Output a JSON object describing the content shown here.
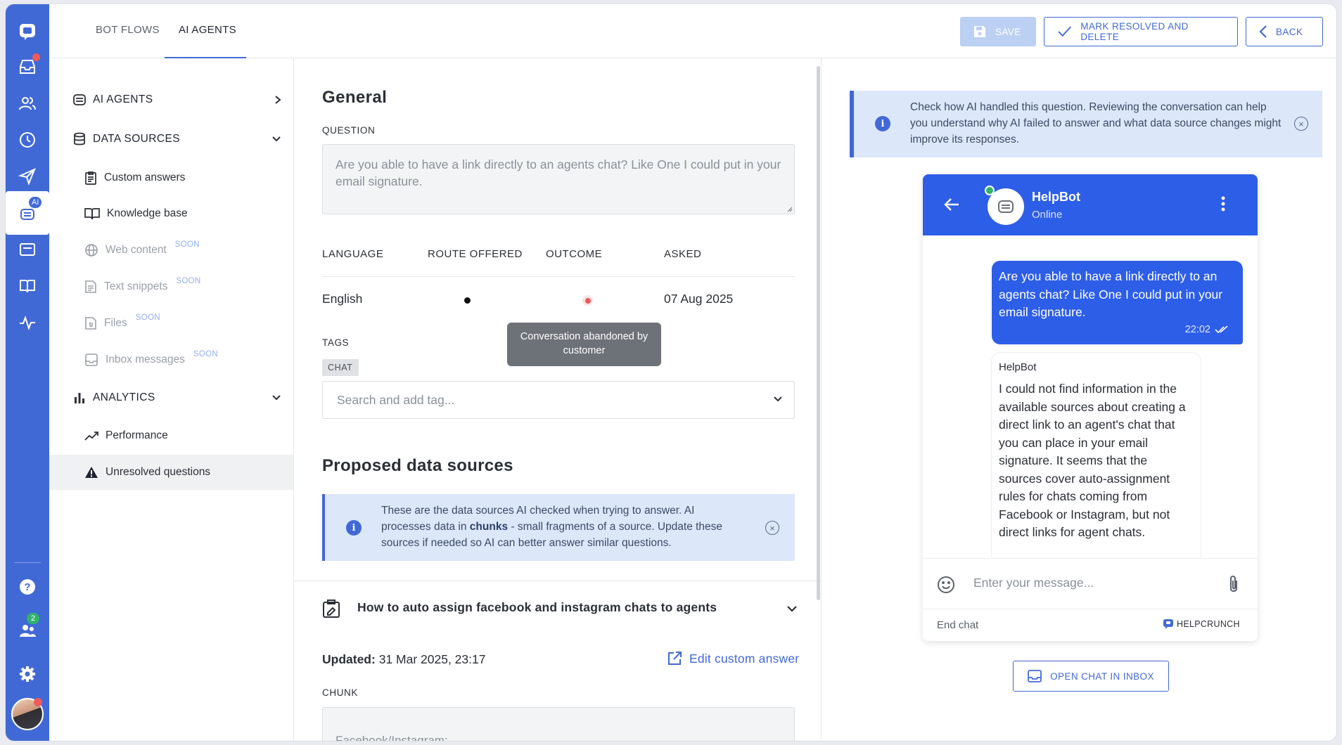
{
  "colors": {
    "accent": "#4169d6",
    "chat_brand": "#2d5ee8",
    "alert_red": "#ef5a5a",
    "online_green": "#2fb36b"
  },
  "rail": {
    "icons": [
      "chat-logo-icon",
      "inbox-icon",
      "contacts-icon",
      "history-icon",
      "send-icon",
      "ai-agents-icon",
      "widget-icon",
      "knowledge-base-icon",
      "activity-icon",
      "help-icon",
      "team-icon",
      "settings-icon"
    ],
    "ai_badge": "AI",
    "team_badge": "2"
  },
  "header": {
    "tabs": [
      {
        "label": "BOT FLOWS"
      },
      {
        "label": "AI AGENTS"
      }
    ],
    "save_label": "SAVE",
    "resolve_label": "MARK RESOLVED AND DELETE",
    "back_label": "BACK"
  },
  "sidebar": {
    "ai_agents": "AI AGENTS",
    "data_sources": "DATA SOURCES",
    "data_source_items": [
      {
        "label": "Custom answers",
        "soon": ""
      },
      {
        "label": "Knowledge base",
        "soon": ""
      },
      {
        "label": "Web content",
        "soon": "SOON"
      },
      {
        "label": "Text snippets",
        "soon": "SOON"
      },
      {
        "label": "Files",
        "soon": "SOON"
      },
      {
        "label": "Inbox messages",
        "soon": "SOON"
      }
    ],
    "analytics": "ANALYTICS",
    "analytics_items": [
      {
        "label": "Performance"
      },
      {
        "label": "Unresolved questions"
      }
    ]
  },
  "general": {
    "title": "General",
    "question_label": "QUESTION",
    "question_value": "Are you able to have a link directly to an agents chat? Like One I could put in your email signature.",
    "columns": {
      "language": "LANGUAGE",
      "route": "ROUTE OFFERED",
      "outcome": "OUTCOME",
      "asked": "ASKED"
    },
    "language": "English",
    "asked": "07 Aug 2025",
    "outcome_tooltip": "Conversation abandoned by customer",
    "tags_label": "TAGS",
    "tag": "CHAT",
    "tag_placeholder": "Search and add tag..."
  },
  "proposed": {
    "title": "Proposed data sources",
    "info_part1": "These are the data sources AI checked when trying to answer. AI processes data in ",
    "info_bold": "chunks",
    "info_part2": " - small fragments of a source. Update these sources if needed so AI can better answer similar questions.",
    "source_title": "How to auto assign facebook and instagram chats to agents",
    "updated_label": "Updated:",
    "updated_value": "31 Mar 2025, 23:17",
    "edit_label": "Edit custom answer",
    "chunk_label": "CHUNK",
    "chunk_text": "Facebook/Instagram:\nTo assign all chats to specific department or an agent:  Create an auto"
  },
  "review": {
    "info": "Check how AI handled this question. Reviewing the conversation can help you understand why AI failed to answer and what data source changes might improve its responses."
  },
  "chat": {
    "bot_name": "HelpBot",
    "status": "Online",
    "user_message": "Are you able to have a link directly to an agents chat? Like One I could put in your email signature.",
    "user_time": "22:02",
    "bot_sender": "HelpBot",
    "bot_message": "I could not find information in the available sources about creating a direct link to an agent's chat that you can place in your email signature. It seems that the sources cover auto-assignment rules for chats coming from Facebook or Instagram, but not direct links for agent chats.",
    "input_placeholder": "Enter your message...",
    "end_chat": "End chat",
    "brand": "HELPCRUNCH"
  },
  "open_inbox_label": "OPEN CHAT IN INBOX"
}
